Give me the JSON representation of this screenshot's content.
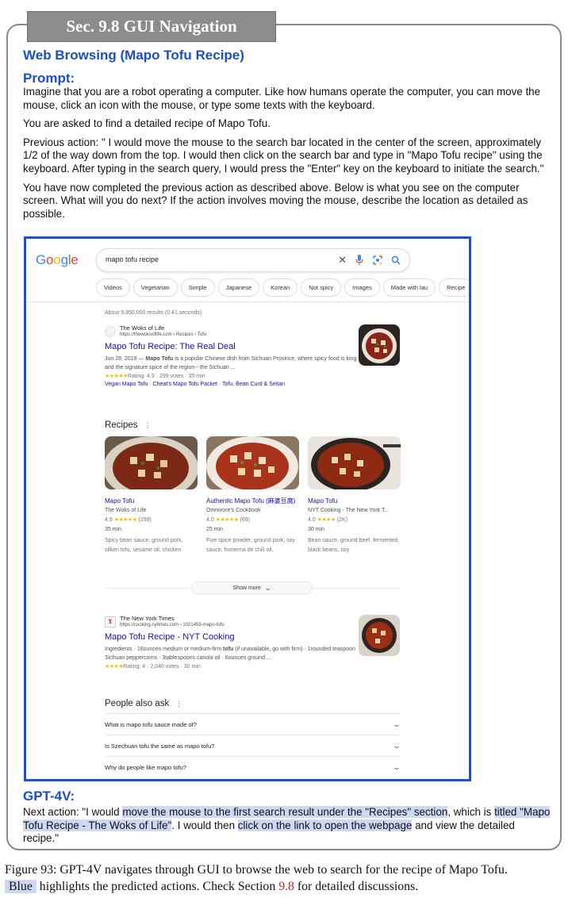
{
  "header": {
    "section_label": "Sec. 9.8 GUI Navigation",
    "task_title": "Web Browsing (Mapo Tofu Recipe)",
    "prompt_label": "Prompt:"
  },
  "prompt": {
    "p1": "Imagine that you are a robot operating a computer. Like how humans operate the computer, you can move the mouse, click an icon with the mouse, or type some texts with the keyboard.",
    "p2": "You are asked to find a detailed recipe of Mapo Tofu.",
    "p3": "Previous action: \" I would move the mouse to the search bar located in the center of the screen, approximately 1/2 of the way down from the top. I would then click on the search bar and type in \"Mapo Tofu recipe\" using the keyboard. After typing in the search query, I would press the \"Enter\" key on the keyboard to initiate the search.\"",
    "p4": "You have now completed the previous action as described above. Below is what you see on the computer screen. What will you do next? If the action involves moving the mouse, describe the location as detailed as possible."
  },
  "screenshot": {
    "logo_letters": [
      "G",
      "o",
      "o",
      "g",
      "l",
      "e"
    ],
    "search_value": "mapo tofu recipe",
    "chips": [
      "Videos",
      "Vegetarian",
      "Simple",
      "Japanese",
      "Korean",
      "Not spicy",
      "Images",
      "Made with lau",
      "Recipe"
    ],
    "stats": "About 9,850,000 results (0.41 seconds)",
    "result1": {
      "site": "The Woks of Life",
      "url": "https://thewoksoflife.com › Recipes › Tofu",
      "title": "Mapo Tofu Recipe: The Real Deal",
      "snippet_date": "Jun 28, 2019 —",
      "snippet_bold": "Mapo Tofu",
      "snippet_rest": "is a popular Chinese dish from Sichuan Province, where spicy food is king and the signature spice of the region-- the Sichuan ...",
      "stars": "★★★★★",
      "rating": "Rating: 4.9 · 299 votes · 35 min",
      "links": "Vegan Mapo Tofu · Cheat's Mapo Tofu Packet · Tofu, Bean Curd & Seitan"
    },
    "recipes_heading": "Recipes",
    "recipes": [
      {
        "name": "Mapo Tofu",
        "source": "The Woks of Life",
        "rating": "4.9",
        "stars": "★★★★★",
        "votes": "(299)",
        "time": "35 min",
        "ingredients": "Spicy bean sauce, ground pork, silken tofu, sesame oil, chicken"
      },
      {
        "name": "Authentic Mapo Tofu (麻婆豆腐)",
        "source": "Omnivore's Cookbook",
        "rating": "4.0",
        "stars": "★★★★★",
        "votes": "(69)",
        "time": "25 min",
        "ingredients": "Five spice powder, ground pork, soy sauce, homema de chili oil,"
      },
      {
        "name": "Mapo Tofu",
        "source": "NYT Cooking - The New York T...",
        "rating": "4.0",
        "stars": "★★★★",
        "votes": "(2K)",
        "time": "30 min",
        "ingredients": "Bean sauce, ground beef, fermented black beans, soy"
      }
    ],
    "show_more": "Show more",
    "result2": {
      "site": "The New York Times",
      "url": "https://cooking.nytimes.com › 1021459-mapo-tofu",
      "title": "Mapo Tofu Recipe - NYT Cooking",
      "snippet_a": "Ingredients · 16ounces medium or medium-firm",
      "snippet_bold": "tofu",
      "snippet_b": "(if unavailable, go with firm) · 1rounded teaspoon Sichuan peppercorns · 3tablespoons canola oil · 6ounces ground ...",
      "stars": "★★★★",
      "rating": "Rating: 4 · 2,040 votes · 30 min"
    },
    "paa_heading": "People also ask",
    "paa": [
      "What is mapo tofu sauce made of?",
      "Is Szechuan tofu the same as mapo tofu?",
      "Why do people like mapo tofu?"
    ]
  },
  "answer": {
    "label": "GPT-4V:",
    "t1": "Next action: \"I would ",
    "h1": "move the mouse to the first search result under the \"Recipes\" section",
    "t2": ", which is ",
    "h2": "titled \"Mapo Tofu Recipe - The Woks of Life\"",
    "t3": ". I would then ",
    "h3": "click on the link to open the webpage",
    "t4": " and view the detailed recipe.\""
  },
  "caption": {
    "c1": "Figure 93: GPT-4V navigates through GUI to browse the web to search for the recipe of Mapo Tofu.",
    "c_blue": "Blue",
    "c2": " highlights the predicted actions. Check Section ",
    "c_ref": "9.8",
    "c3": " for detailed discussions."
  },
  "colors": {
    "heading_blue": "#1a4fc4",
    "highlight": "#cdd8f5",
    "screenshot_border": "#1e50d6",
    "link_blue": "#1a0dab",
    "section_ref_red": "#c62828"
  }
}
